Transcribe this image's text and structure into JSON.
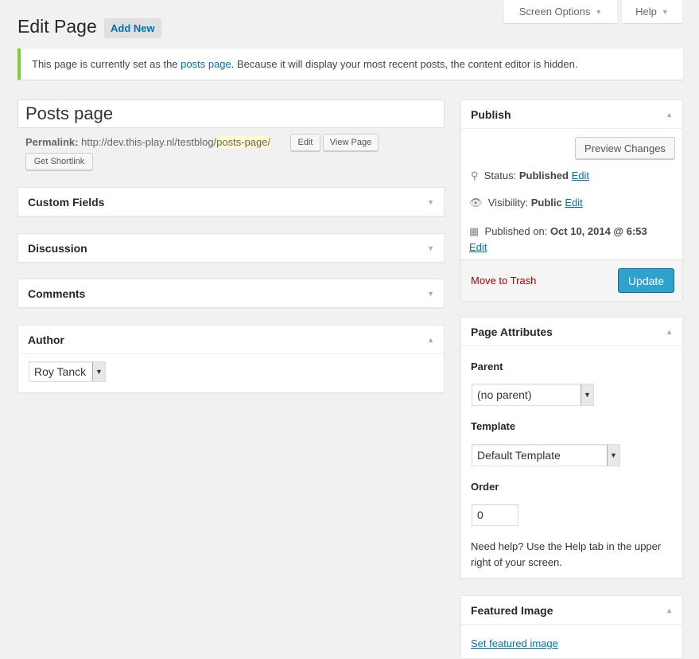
{
  "header": {
    "screen_options": "Screen Options",
    "help": "Help",
    "title": "Edit Page",
    "add_new": "Add New"
  },
  "notice": {
    "before": "This page is currently set as the ",
    "link": "posts page",
    "after": ". Because it will display your most recent posts, the content editor is hidden."
  },
  "post": {
    "title": "Posts page",
    "permalink_label": "Permalink:",
    "permalink_base": "http://dev.this-play.nl/testblog/",
    "permalink_slug": "posts-page/",
    "edit": "Edit",
    "view_page": "View Page",
    "get_shortlink": "Get Shortlink"
  },
  "boxes": {
    "custom_fields": "Custom Fields",
    "discussion": "Discussion",
    "comments": "Comments",
    "author": "Author",
    "author_value": "Roy Tanck"
  },
  "publish": {
    "title": "Publish",
    "preview": "Preview Changes",
    "status_label": "Status:",
    "status": "Published",
    "visibility_label": "Visibility:",
    "visibility": "Public",
    "published_label": "Published on:",
    "published": "Oct 10, 2014 @ 6:53",
    "edit": "Edit",
    "trash": "Move to Trash",
    "update": "Update"
  },
  "attributes": {
    "title": "Page Attributes",
    "parent_label": "Parent",
    "parent": "(no parent)",
    "template_label": "Template",
    "template": "Default Template",
    "order_label": "Order",
    "order": "0",
    "help": "Need help? Use the Help tab in the upper right of your screen."
  },
  "featured": {
    "title": "Featured Image",
    "link": "Set featured image"
  },
  "colors": {
    "accent": "#0073aa",
    "update": "#2ea2cc",
    "notice": "#7ad03a",
    "trash": "#a00"
  }
}
